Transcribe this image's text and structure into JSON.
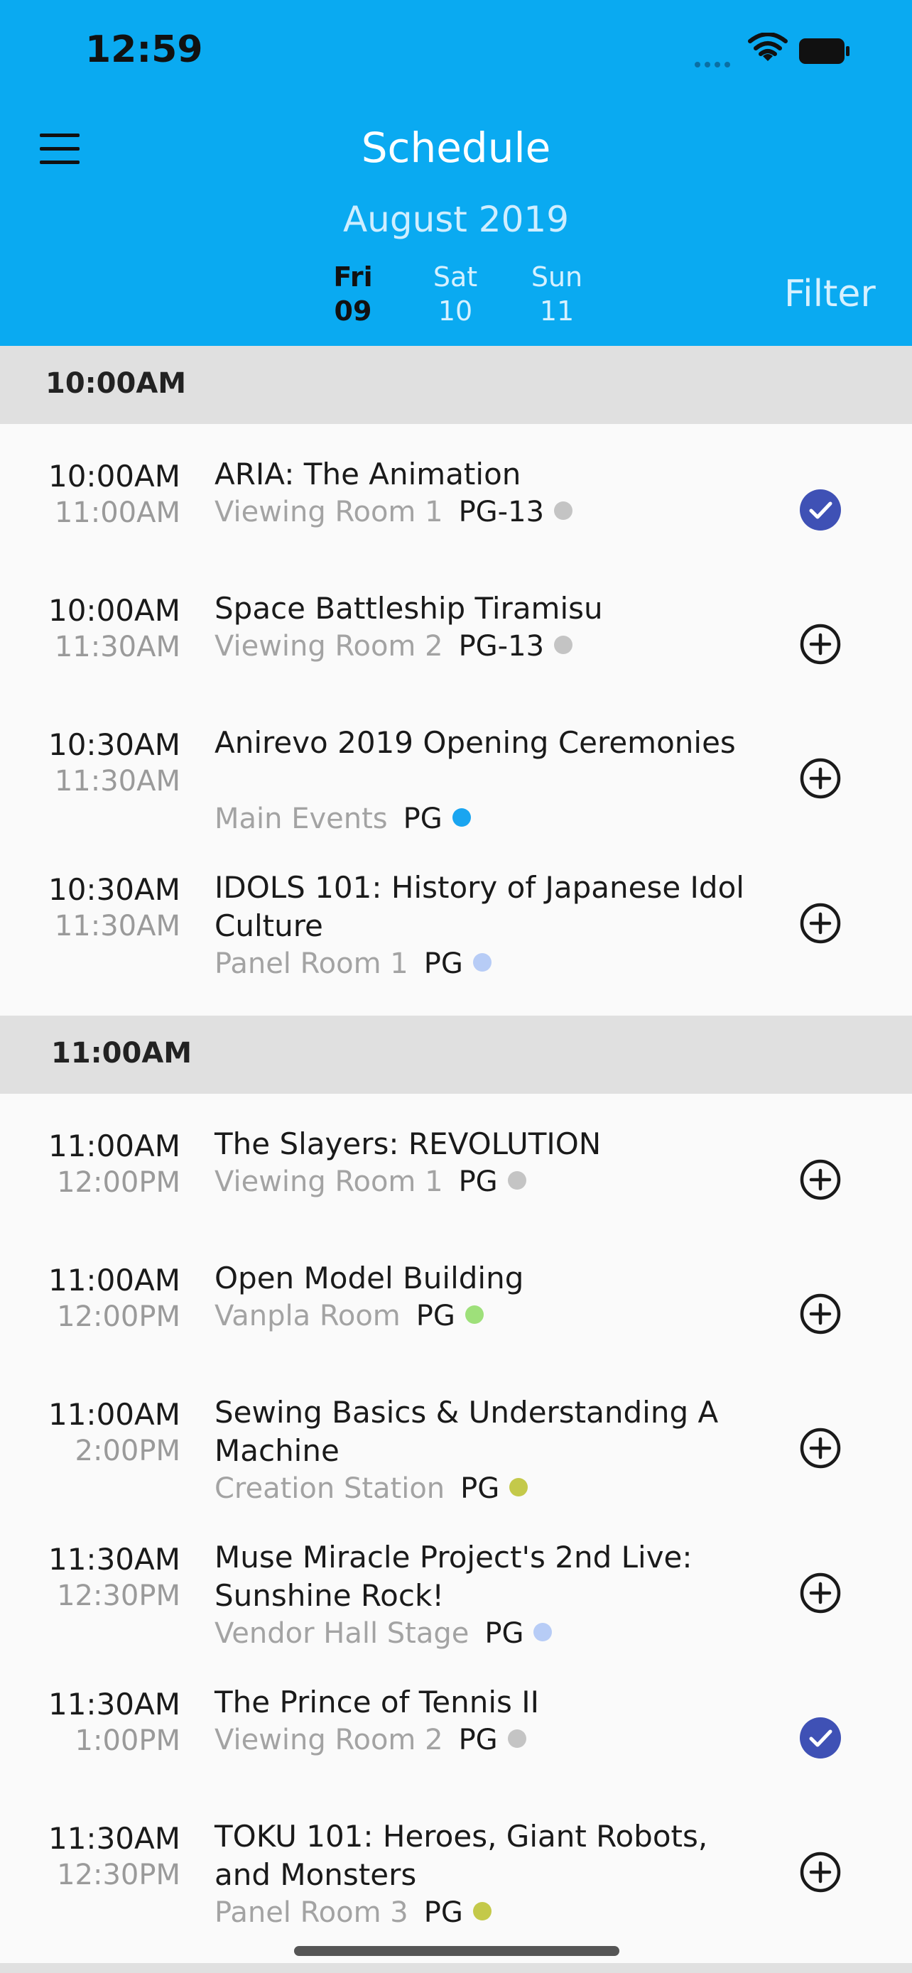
{
  "status": {
    "time": "12:59"
  },
  "header": {
    "title": "Schedule",
    "month": "August 2019",
    "days": [
      {
        "dow": "Fri",
        "date": "09"
      },
      {
        "dow": "Sat",
        "date": "10"
      },
      {
        "dow": "Sun",
        "date": "11"
      }
    ],
    "filter_label": "Filter"
  },
  "sections": [
    {
      "label": "10:00AM",
      "events": [
        {
          "start": "10:00AM",
          "end": "11:00AM",
          "title": "ARIA: The Animation",
          "room": "Viewing Room 1",
          "rating": "PG-13",
          "dot_color": "#c4c4c4",
          "added": true
        },
        {
          "start": "10:00AM",
          "end": "11:30AM",
          "title": "Space Battleship Tiramisu",
          "room": "Viewing Room 2",
          "rating": "PG-13",
          "dot_color": "#c4c4c4",
          "added": false
        },
        {
          "start": "10:30AM",
          "end": "11:30AM",
          "title": "Anirevo 2019 Opening Ceremonies",
          "room": "Main Events",
          "rating": "PG",
          "dot_color": "#1aa5f0",
          "added": false
        },
        {
          "start": "10:30AM",
          "end": "11:30AM",
          "title": "IDOLS 101: History of Japanese Idol Culture",
          "room": "Panel Room 1",
          "rating": "PG",
          "dot_color": "#b7ccf6",
          "added": false
        }
      ]
    },
    {
      "label": "11:00AM",
      "events": [
        {
          "start": "11:00AM",
          "end": "12:00PM",
          "title": "The Slayers: REVOLUTION",
          "room": "Viewing Room 1",
          "rating": "PG",
          "dot_color": "#c4c4c4",
          "added": false
        },
        {
          "start": "11:00AM",
          "end": "12:00PM",
          "title": "Open Model Building",
          "room": "Vanpla Room",
          "rating": "PG",
          "dot_color": "#9ee07a",
          "added": false
        },
        {
          "start": "11:00AM",
          "end": "2:00PM",
          "title": "Sewing Basics & Understanding A Machine",
          "room": "Creation Station",
          "rating": "PG",
          "dot_color": "#c4c94a",
          "added": false
        },
        {
          "start": "11:30AM",
          "end": "12:30PM",
          "title": "Muse Miracle Project's 2nd Live: Sunshine Rock!",
          "room": "Vendor Hall Stage",
          "rating": "PG",
          "dot_color": "#b7ccf6",
          "added": false
        },
        {
          "start": "11:30AM",
          "end": "1:00PM",
          "title": "The Prince of Tennis II",
          "room": "Viewing Room 2",
          "rating": "PG",
          "dot_color": "#c4c4c4",
          "added": true
        },
        {
          "start": "11:30AM",
          "end": "12:30PM",
          "title": "TOKU 101: Heroes, Giant Robots, and Monsters",
          "room": "Panel Room 3",
          "rating": "PG",
          "dot_color": "#c4c94a",
          "added": false
        }
      ]
    }
  ],
  "colors": {
    "header_bg": "#0aaaf1",
    "check_fill": "#3f51b5",
    "section_bg": "#e0e0e0"
  }
}
